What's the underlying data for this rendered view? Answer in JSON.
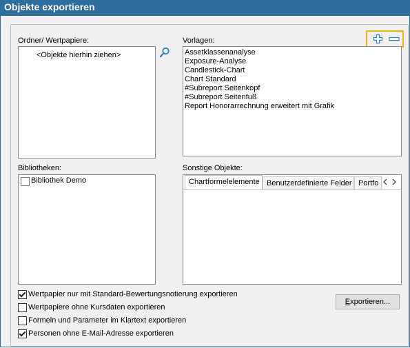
{
  "window": {
    "title": "Objekte exportieren"
  },
  "folders": {
    "label": "Ordner/ Wertpapiere:",
    "placeholder": "<Objekte hierhin ziehen>"
  },
  "templates": {
    "label": "Vorlagen:",
    "items": [
      "Assetklassenanalyse",
      "Exposure-Analyse",
      "Candlestick-Chart",
      "Chart Standard",
      "#Subreport Seitenkopf",
      "#Subreport Seitenfuß",
      "Report Honorarrechnung erweitert mit Grafik"
    ]
  },
  "libraries": {
    "label": "Bibliotheken:",
    "items": [
      {
        "label": "Bibliothek Demo",
        "checked": false
      }
    ]
  },
  "other_objects": {
    "label": "Sonstige Objekte:",
    "tabs": [
      "Chartformelelemente",
      "Benutzerdefinierte Felder",
      "Portfo"
    ],
    "active_tab": 0
  },
  "options": [
    {
      "label": "Wertpapier nur mit Standard-Bewertungsnotierung exportieren",
      "checked": true
    },
    {
      "label": "Wertpapiere ohne Kursdaten exportieren",
      "checked": false
    },
    {
      "label": "Formeln und Parameter im Klartext exportieren",
      "checked": false
    },
    {
      "label": "Personen ohne E-Mail-Adresse exportieren",
      "checked": true
    }
  ],
  "export_button": {
    "label_prefix": "E",
    "label_rest": "xportieren..."
  },
  "icons": {
    "search": "magnifier-icon",
    "add": "plus-icon",
    "remove": "minus-icon"
  },
  "colors": {
    "titlebar": "#2e6e9e",
    "highlight": "#f4b400",
    "icon_blue": "#2f7fc6"
  }
}
